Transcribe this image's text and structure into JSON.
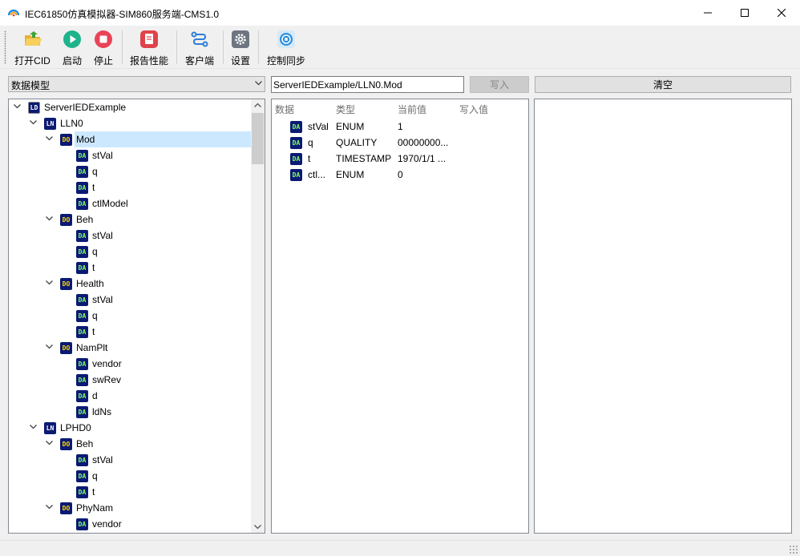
{
  "window": {
    "title": "IEC61850仿真模拟器-SIM860服务端-CMS1.0",
    "icon": "app-logo-icon"
  },
  "toolbar": {
    "items": [
      {
        "label": "打开CID",
        "icon": "folder-open-icon"
      },
      {
        "label": "启动",
        "icon": "play-icon"
      },
      {
        "label": "停止",
        "icon": "stop-icon"
      },
      {
        "label": "报告性能",
        "icon": "report-icon"
      },
      {
        "label": "客户端",
        "icon": "client-icon"
      },
      {
        "label": "设置",
        "icon": "gear-icon"
      },
      {
        "label": "控制同步",
        "icon": "sync-icon"
      }
    ]
  },
  "left": {
    "combo_value": "数据模型",
    "tree": [
      {
        "type": "LD",
        "label": "ServerIEDExample",
        "level": 0,
        "expanded": true
      },
      {
        "type": "LN",
        "label": "LLN0",
        "level": 1,
        "expanded": true
      },
      {
        "type": "DO",
        "label": "Mod",
        "level": 2,
        "expanded": true,
        "selected": true
      },
      {
        "type": "DA",
        "label": "stVal",
        "level": 3
      },
      {
        "type": "DA",
        "label": "q",
        "level": 3
      },
      {
        "type": "DA",
        "label": "t",
        "level": 3
      },
      {
        "type": "DA",
        "label": "ctlModel",
        "level": 3
      },
      {
        "type": "DO",
        "label": "Beh",
        "level": 2,
        "expanded": true
      },
      {
        "type": "DA",
        "label": "stVal",
        "level": 3
      },
      {
        "type": "DA",
        "label": "q",
        "level": 3
      },
      {
        "type": "DA",
        "label": "t",
        "level": 3
      },
      {
        "type": "DO",
        "label": "Health",
        "level": 2,
        "expanded": true
      },
      {
        "type": "DA",
        "label": "stVal",
        "level": 3
      },
      {
        "type": "DA",
        "label": "q",
        "level": 3
      },
      {
        "type": "DA",
        "label": "t",
        "level": 3
      },
      {
        "type": "DO",
        "label": "NamPlt",
        "level": 2,
        "expanded": true
      },
      {
        "type": "DA",
        "label": "vendor",
        "level": 3
      },
      {
        "type": "DA",
        "label": "swRev",
        "level": 3
      },
      {
        "type": "DA",
        "label": "d",
        "level": 3
      },
      {
        "type": "DA",
        "label": "ldNs",
        "level": 3
      },
      {
        "type": "LN",
        "label": "LPHD0",
        "level": 1,
        "expanded": true
      },
      {
        "type": "DO",
        "label": "Beh",
        "level": 2,
        "expanded": true
      },
      {
        "type": "DA",
        "label": "stVal",
        "level": 3
      },
      {
        "type": "DA",
        "label": "q",
        "level": 3
      },
      {
        "type": "DA",
        "label": "t",
        "level": 3
      },
      {
        "type": "DO",
        "label": "PhyNam",
        "level": 2,
        "expanded": true
      },
      {
        "type": "DA",
        "label": "vendor",
        "level": 3
      }
    ]
  },
  "middle": {
    "path_value": "ServerIEDExample/LLN0.Mod",
    "write_label": "写入",
    "columns": [
      "数据",
      "类型",
      "当前值",
      "写入值"
    ],
    "rows": [
      {
        "type": "DA",
        "name": "stVal",
        "dtype": "ENUM",
        "value": "1",
        "write": ""
      },
      {
        "type": "DA",
        "name": "q",
        "dtype": "QUALITY",
        "value": "00000000...",
        "write": ""
      },
      {
        "type": "DA",
        "name": "t",
        "dtype": "TIMESTAMP",
        "value": "1970/1/1 ...",
        "write": ""
      },
      {
        "type": "DA",
        "name": "ctl...",
        "dtype": "ENUM",
        "value": "0",
        "write": ""
      }
    ]
  },
  "right": {
    "clear_label": "清空"
  },
  "colors": {
    "badge_bg": "#0b1a73",
    "do_text": "#ffd700",
    "da_text": "#7fff6a",
    "selection": "#cce8ff"
  }
}
